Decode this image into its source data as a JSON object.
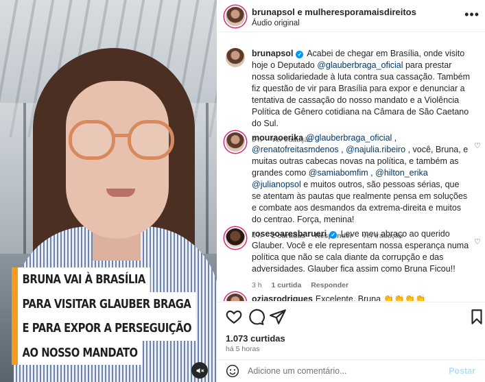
{
  "video": {
    "caption_lines": [
      "BRUNA VAI À BRASÍLIA",
      "PARA VISITAR GLAUBER BRAGA",
      "E PARA EXPOR A PERSEGUIÇÃO",
      "AO NOSSO MANDATO"
    ],
    "accent_color": "#f39a1f",
    "mute_icon": "speaker-muted-icon"
  },
  "header": {
    "authors": "brunapsol e mulheresporamaisdireitos",
    "audio": "Áudio original",
    "more_icon": "more-options-icon"
  },
  "caption_post": {
    "user": "brunapsol",
    "text_before": "Acabei de chegar em Brasília, onde visito hoje o Deputado ",
    "mention": "@glauberbraga_oficial",
    "text_after": " para prestar nossa solidariedade à luta contra sua cassação. Também fiz questão de vir para Brasília para expor e denunciar a tentativa de cassação do nosso mandato e a Violência Política de Gênero cotidiana na Câmara de São Caetano do Sul.",
    "time": "5 h",
    "translate": "Ver tradução"
  },
  "comments": [
    {
      "user": "mouraoerika",
      "parts": [
        {
          "t": "m",
          "v": "@glauberbraga_oficial"
        },
        {
          "t": "s",
          "v": " , "
        },
        {
          "t": "m",
          "v": "@renatofreitasmdenos"
        },
        {
          "t": "s",
          "v": " , "
        },
        {
          "t": "m",
          "v": "@najulia.ribeiro"
        },
        {
          "t": "s",
          "v": " , você, Bruna, e muitas outras cabecas novas na política, e também as grandes como "
        },
        {
          "t": "m",
          "v": "@samiabomfim"
        },
        {
          "t": "s",
          "v": " , "
        },
        {
          "t": "m",
          "v": "@hilton_erika"
        },
        {
          "t": "s",
          "v": " "
        },
        {
          "t": "m",
          "v": "@julianopsol"
        },
        {
          "t": "s",
          "v": " e muitos outros, são pessoas sérias, que se atentam às pautas que realmente pensa em soluções e combate aos desmandos da extrema-direita e muitos do centrao. Força, menina!"
        }
      ],
      "time": "4 h",
      "likes": "2 curtidas",
      "reply": "Responder",
      "translate": "Ver tradução"
    },
    {
      "user": "rosesoaresbarueri",
      "verified": true,
      "parts": [
        {
          "t": "s",
          "v": "Leve meu abraço ao querido Glauber. Você e ele representam nossa esperança numa política que não se cala diante da corrupção e das adversidades. Glauber fica assim como Bruna Ficou!!"
        }
      ],
      "time": "3 h",
      "likes": "1 curtida",
      "reply": "Responder"
    },
    {
      "user": "oziasrodrigues",
      "parts": [
        {
          "t": "s",
          "v": "Excelente, Bruna 👏👏👏👏"
        }
      ]
    }
  ],
  "actions": {
    "like_icon": "heart-icon",
    "comment_icon": "comment-icon",
    "share_icon": "share-icon",
    "save_icon": "bookmark-icon",
    "likes": "1.073 curtidas",
    "time": "há 5 horas"
  },
  "add_comment": {
    "placeholder": "Adicione um comentário...",
    "post_label": "Postar",
    "emoji_icon": "emoji-icon"
  }
}
